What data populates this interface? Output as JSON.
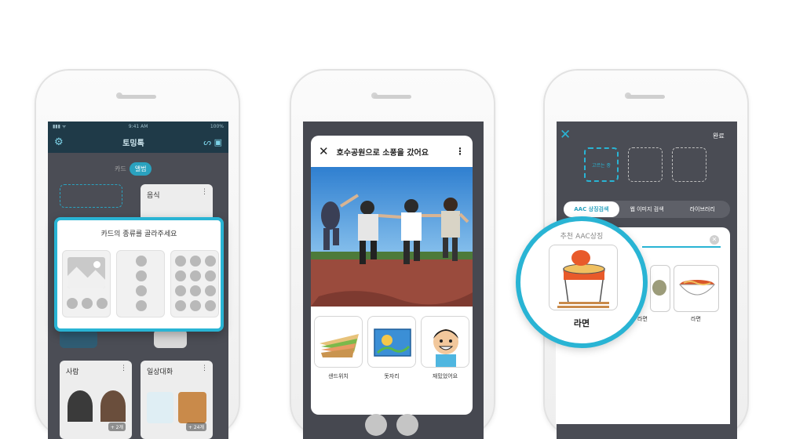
{
  "phone1": {
    "status_time": "9:41 AM",
    "status_battery": "100%",
    "app_title": "토밍톡",
    "seg_card": "카드",
    "seg_album": "앨범",
    "card_music": "음식",
    "card_people": "사람",
    "card_daily": "일상대화",
    "badge_count_1": "+ 2개",
    "badge_count_2": "+ 24개",
    "dialog_title": "카드의 종류를 골라주세요"
  },
  "phone2": {
    "card_title": "호수공원으로 소풍을 갔어요",
    "symbols": [
      "샌드위치",
      "돗자리",
      "재밌었어요"
    ]
  },
  "phone3": {
    "done_label": "완료",
    "slot_selecting": "고르는 중",
    "tabs": [
      "AAC 상징검색",
      "웹 이미지 검색",
      "라이브러리"
    ],
    "recommend_label": "추천 AAC상징",
    "zoom_label": "라면",
    "result_labels": [
      "라면",
      "라면"
    ]
  },
  "colors": {
    "accent": "#29b4d4",
    "dark": "#4a4c54"
  }
}
